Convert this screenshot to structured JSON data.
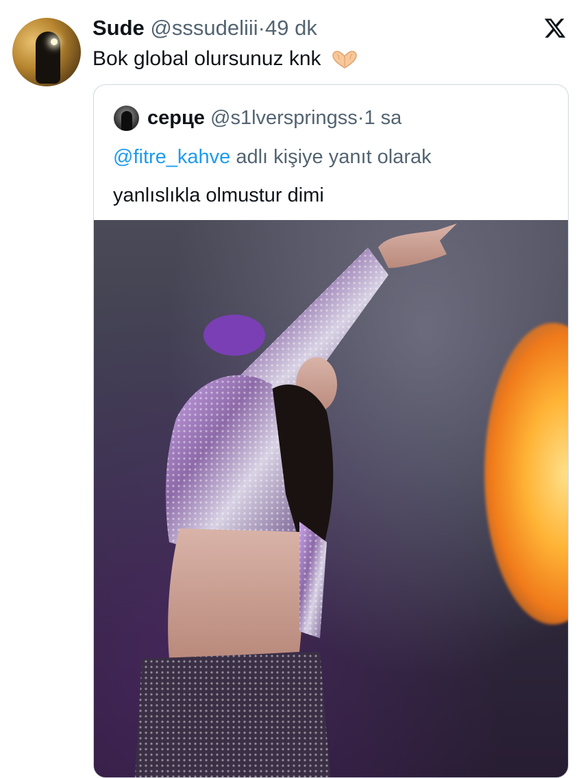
{
  "tweet": {
    "author_name": "Sude",
    "author_handle": "@sssudeliii",
    "separator": "·",
    "time": "49 dk",
    "text": "Bok global olursunuz knk",
    "emoji_icon": "heart-hands-icon"
  },
  "platform_logo": "x-logo-icon",
  "quoted": {
    "author_name": "серце",
    "author_handle": "@s1lverspringss",
    "separator": "·",
    "time": "1 sa",
    "reply_to_mention": "@fitre_kahve",
    "reply_to_suffix": " adlı kişiye yanıt olarak",
    "text": "yanlıslıkla olmustur dimi",
    "media": "concert-photo"
  },
  "colors": {
    "link": "#1d9bf0",
    "secondary_text": "#536471",
    "border": "#cfd9de"
  }
}
